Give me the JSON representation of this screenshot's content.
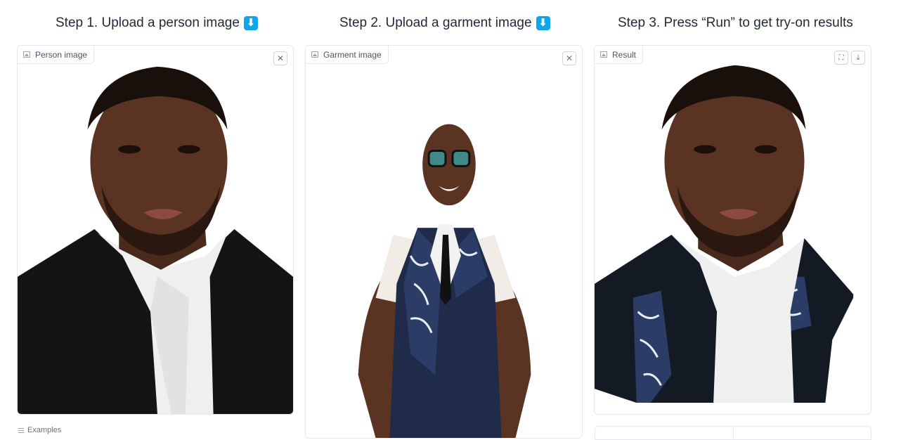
{
  "steps": [
    {
      "title": "Step 1. Upload a person image",
      "emoji": "⬇"
    },
    {
      "title": "Step 2. Upload a garment image",
      "emoji": "⬇"
    },
    {
      "title": "Step 3. Press “Run” to get try-on results"
    }
  ],
  "panels": {
    "person": {
      "label": "Person image",
      "clear_icon": "close-icon"
    },
    "garment": {
      "label": "Garment image",
      "clear_icon": "close-icon"
    },
    "result": {
      "label": "Result",
      "fullscreen_icon": "fullscreen-icon",
      "download_icon": "download-icon"
    }
  },
  "examples": {
    "label": "Examples"
  },
  "colors": {
    "skin": "#5a3322",
    "suit": "#141414",
    "shirt": "#f2f2f2",
    "vest": "#1f2b48",
    "pattern": "#e8eef6",
    "accent": "#0ea5e9"
  }
}
